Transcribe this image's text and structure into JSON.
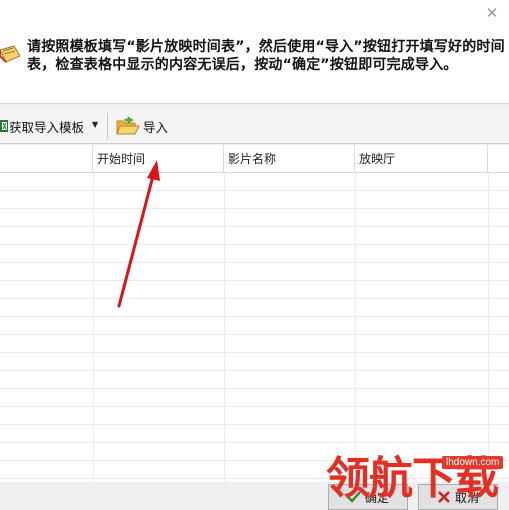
{
  "instruction": {
    "text": "请按照模板填写“影片放映时间表”，然后使用“导入”按钮打开填写好的时间表，检查表格中显示的内容无误后，按动“确定”按钮即可完成导入。"
  },
  "toolbar": {
    "get_template_label": "获取导入模板",
    "import_label": "导入"
  },
  "grid": {
    "columns": [
      "",
      "开始时间",
      "影片名称",
      "放映厅"
    ],
    "row_count": 17
  },
  "footer": {
    "ok_label": "确定",
    "cancel_label": "取消"
  },
  "watermark": {
    "text": "领航下载",
    "url": "lhdown.com"
  },
  "colors": {
    "arrow": "#d8151b",
    "watermark": "#e23024"
  },
  "icons": {
    "close": "close-icon",
    "note": "note-icon",
    "excel": "excel-icon",
    "folder": "folder-open-icon",
    "ok": "check-icon",
    "cancel": "cross-icon"
  }
}
